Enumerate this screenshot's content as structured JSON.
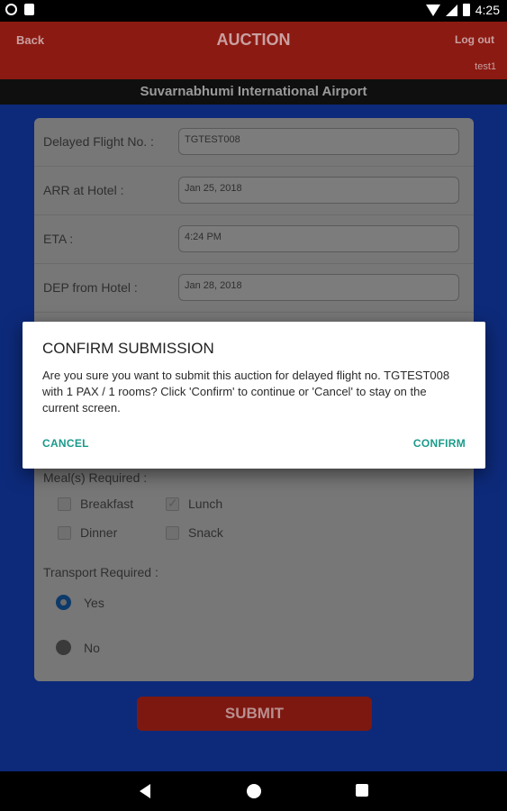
{
  "status_bar": {
    "time": "4:25",
    "icons": [
      "notification-icon",
      "sd-card-icon",
      "wifi-icon",
      "signal-icon",
      "battery-icon"
    ]
  },
  "app_bar": {
    "back_label": "Back",
    "title": "AUCTION",
    "logout_label": "Log out",
    "username": "test1"
  },
  "airport": {
    "name": "Suvarnabhumi International Airport"
  },
  "form": {
    "fields": [
      {
        "label": "Delayed Flight No. :",
        "value": "TGTEST008"
      },
      {
        "label": "ARR at Hotel :",
        "value": "Jan 25, 2018"
      },
      {
        "label": "ETA :",
        "value": "4:24 PM"
      },
      {
        "label": "DEP from Hotel :",
        "value": "Jan 28, 2018"
      }
    ],
    "meals": {
      "label": "Meal(s) Required :",
      "options": [
        {
          "label": "Breakfast",
          "checked": false
        },
        {
          "label": "Lunch",
          "checked": true
        },
        {
          "label": "Dinner",
          "checked": false
        },
        {
          "label": "Snack",
          "checked": false
        }
      ]
    },
    "transport": {
      "label": "Transport Required :",
      "options": [
        {
          "label": "Yes",
          "selected": true
        },
        {
          "label": "No",
          "selected": false
        }
      ]
    },
    "submit_label": "SUBMIT"
  },
  "dialog": {
    "title": "CONFIRM SUBMISSION",
    "message": "Are you sure you want to submit this auction for delayed flight no. TGTEST008 with 1 PAX / 1 rooms? Click 'Confirm' to continue or 'Cancel' to stay on the current screen.",
    "cancel_label": "CANCEL",
    "confirm_label": "CONFIRM"
  },
  "colors": {
    "app_bar": "#8b1a12",
    "background": "#0d2a7a",
    "dialog_button": "#1a9a8a"
  }
}
